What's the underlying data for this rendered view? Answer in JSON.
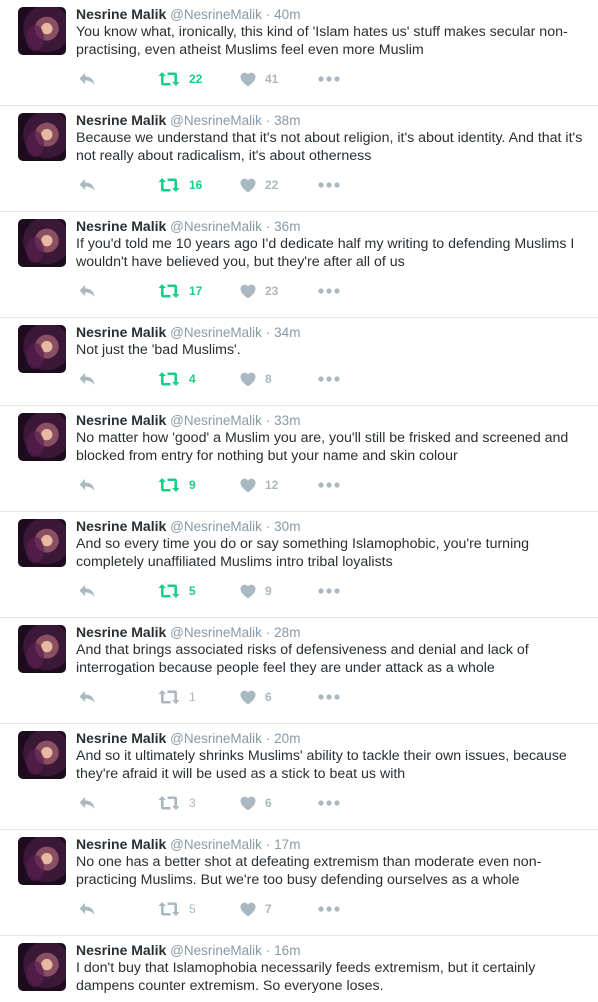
{
  "colors": {
    "retweet_active": "#19cf86",
    "icon_gray": "#aab8c2",
    "muted_text": "#8899a6",
    "divider": "#e1e8ed"
  },
  "icons": {
    "reply": "reply-icon",
    "retweet": "retweet-icon",
    "like": "heart-icon",
    "more": "more-icon",
    "avatar": "avatar"
  },
  "tweets": [
    {
      "name": "Nesrine Malik",
      "handle": "@NesrineMalik",
      "sep": "·",
      "time": "40m",
      "text": "You know what, ironically, this kind of 'Islam hates us' stuff makes secular non-practising, even atheist Muslims feel even more Muslim",
      "retweets": "22",
      "likes": "41",
      "retweeted": true
    },
    {
      "name": "Nesrine Malik",
      "handle": "@NesrineMalik",
      "sep": "·",
      "time": "38m",
      "text": "Because we understand that it's not about religion, it's about identity. And that it's not really about radicalism, it's about otherness",
      "retweets": "16",
      "likes": "22",
      "retweeted": true
    },
    {
      "name": "Nesrine Malik",
      "handle": "@NesrineMalik",
      "sep": "·",
      "time": "36m",
      "text": "If you'd told me 10 years ago I'd dedicate half my writing to defending Muslims I wouldn't have believed you, but they're after all of us",
      "retweets": "17",
      "likes": "23",
      "retweeted": true
    },
    {
      "name": "Nesrine Malik",
      "handle": "@NesrineMalik",
      "sep": "·",
      "time": "34m",
      "text": "Not just the 'bad Muslims'.",
      "retweets": "4",
      "likes": "8",
      "retweeted": true
    },
    {
      "name": "Nesrine Malik",
      "handle": "@NesrineMalik",
      "sep": "·",
      "time": "33m",
      "text": "No matter how 'good' a Muslim you are, you'll still be frisked and screened and blocked from entry for nothing but your name and skin colour",
      "retweets": "9",
      "likes": "12",
      "retweeted": true
    },
    {
      "name": "Nesrine Malik",
      "handle": "@NesrineMalik",
      "sep": "·",
      "time": "30m",
      "text": "And so every time you do or say something Islamophobic, you're turning completely unaffiliated Muslims intro tribal loyalists",
      "retweets": "5",
      "likes": "9",
      "retweeted": true
    },
    {
      "name": "Nesrine Malik",
      "handle": "@NesrineMalik",
      "sep": "·",
      "time": "28m",
      "text": "And that brings associated risks of defensiveness and denial and lack of interrogation because people feel they are under attack as a whole",
      "retweets": "1",
      "likes": "6",
      "retweeted": false
    },
    {
      "name": "Nesrine Malik",
      "handle": "@NesrineMalik",
      "sep": "·",
      "time": "20m",
      "text": "And so it ultimately shrinks Muslims' ability to tackle their own issues, because they're afraid it will be used as a stick to beat us with",
      "retweets": "3",
      "likes": "6",
      "retweeted": false
    },
    {
      "name": "Nesrine Malik",
      "handle": "@NesrineMalik",
      "sep": "·",
      "time": "17m",
      "text": "No one has a better shot at defeating extremism than moderate even non-practicing Muslims. But we're too busy defending ourselves as a whole",
      "retweets": "5",
      "likes": "7",
      "retweeted": false
    },
    {
      "name": "Nesrine Malik",
      "handle": "@NesrineMalik",
      "sep": "·",
      "time": "16m",
      "text": "I don't buy that Islamophobia necessarily feeds extremism, but it certainly dampens counter extremism. So everyone loses.",
      "retweets": "",
      "likes": "",
      "retweeted": false,
      "no_actions": true
    }
  ]
}
